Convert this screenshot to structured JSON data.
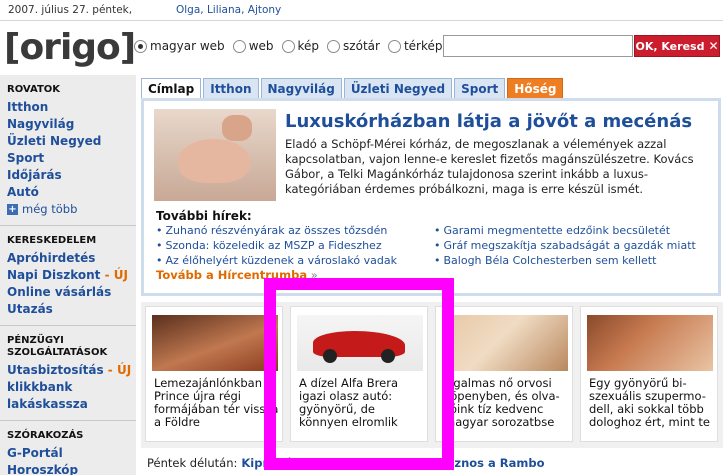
{
  "topbar": {
    "date": "2007. július 27. péntek,",
    "names": "Olga, Liliana, Ajtony"
  },
  "header": {
    "logo": "[origo]",
    "radios": [
      {
        "label": "magyar web",
        "checked": true
      },
      {
        "label": "web",
        "checked": false
      },
      {
        "label": "kép",
        "checked": false
      },
      {
        "label": "szótár",
        "checked": false
      },
      {
        "label": "térkép",
        "checked": false
      }
    ],
    "search_placeholder": "",
    "search_button": "OK, Keresd",
    "search_button_icon": "x-icon"
  },
  "sidebar": {
    "rovatok": {
      "title": "ROVATOK",
      "items": [
        "Itthon",
        "Nagyvilág",
        "Üzleti Negyed",
        "Sport",
        "Időjárás",
        "Autó"
      ],
      "more": "még több"
    },
    "kereskedelem": {
      "title": "KERESKEDELEM",
      "items": [
        {
          "label": "Apróhirdetés",
          "new": ""
        },
        {
          "label": "Napi Diszkont",
          "new": " - ÚJ"
        },
        {
          "label": "Online vásárlás",
          "new": ""
        },
        {
          "label": "Utazás",
          "new": ""
        }
      ]
    },
    "penzugyi": {
      "title_line1": "PÉNZÜGYI",
      "title_line2": "SZOLGÁLTATÁSOK",
      "items": [
        {
          "label": "Utasbiztosítás",
          "new": " - ÚJ"
        },
        {
          "label": "klikkbank",
          "new": ""
        },
        {
          "label": "lakáskassza",
          "new": ""
        }
      ]
    },
    "szorakozas": {
      "title": "SZÓRAKOZÁS",
      "items": [
        "G-Portál",
        "Horoszkóp"
      ]
    }
  },
  "tabs": [
    {
      "label": "Címlap",
      "state": "active"
    },
    {
      "label": "Itthon",
      "state": "normal"
    },
    {
      "label": "Nagyvilág",
      "state": "normal"
    },
    {
      "label": "Üzleti Negyed",
      "state": "normal"
    },
    {
      "label": "Sport",
      "state": "normal"
    },
    {
      "label": "Hőség",
      "state": "orange"
    }
  ],
  "lead": {
    "title": "Luxuskórházban látja a jövőt a mecénás",
    "body": "Eladó a Schöpf-Mérei kórház, de megoszlanak a vélemények azzal kapcsolatban, vajon lenne-e kereslet fizetős magánszülészetre. Kovács Gábor, a Telki Magánkórház tulajdonosa szerint inkább a luxus-kategóriában érdemes próbálkozni, maga is erre készül ismét.",
    "more_title": "További hírek:",
    "links": [
      "Zuhanó részvényárak az összes tőzsdén",
      "Garami megmentette edzőink becsületét",
      "Szonda: közeledik az MSZP a Fideszhez",
      "Gráf megszakítja szabadságát a gazdák miatt",
      "Az élőhelyért küzdenek a városlakó vadak",
      "Balogh Béla Colchesterben sem kellett"
    ],
    "hircentrum": "Tovább a Hírcentrumba",
    "hircentrum_arrow": " »"
  },
  "promos": [
    {
      "caption": "Lemezajánlónkban Prince újra régi formájában tér vissza a Földre"
    },
    {
      "caption": "A dízel Alfa Brera igazi olasz autó: gyönyörű, de könnyen elromlik"
    },
    {
      "caption": "Izgalmas nő orvosi köpenyben, és olva-sóink tíz kedvenc magyar sorozatbse"
    },
    {
      "caption": "Egy gyönyörű bi-szexuális szupermo-dell, aki sokkal több dologhoz ért, mint te"
    }
  ],
  "bottom": {
    "prefix": "Péntek délután:",
    "link": "Kipróbáltuk, hogy mikor lesz hasznos a Rambo"
  },
  "colors": {
    "accent_blue": "#1f4f9a",
    "orange": "#e06a00",
    "search_red": "#cc1d2e",
    "highlight": "#ff00ff"
  }
}
